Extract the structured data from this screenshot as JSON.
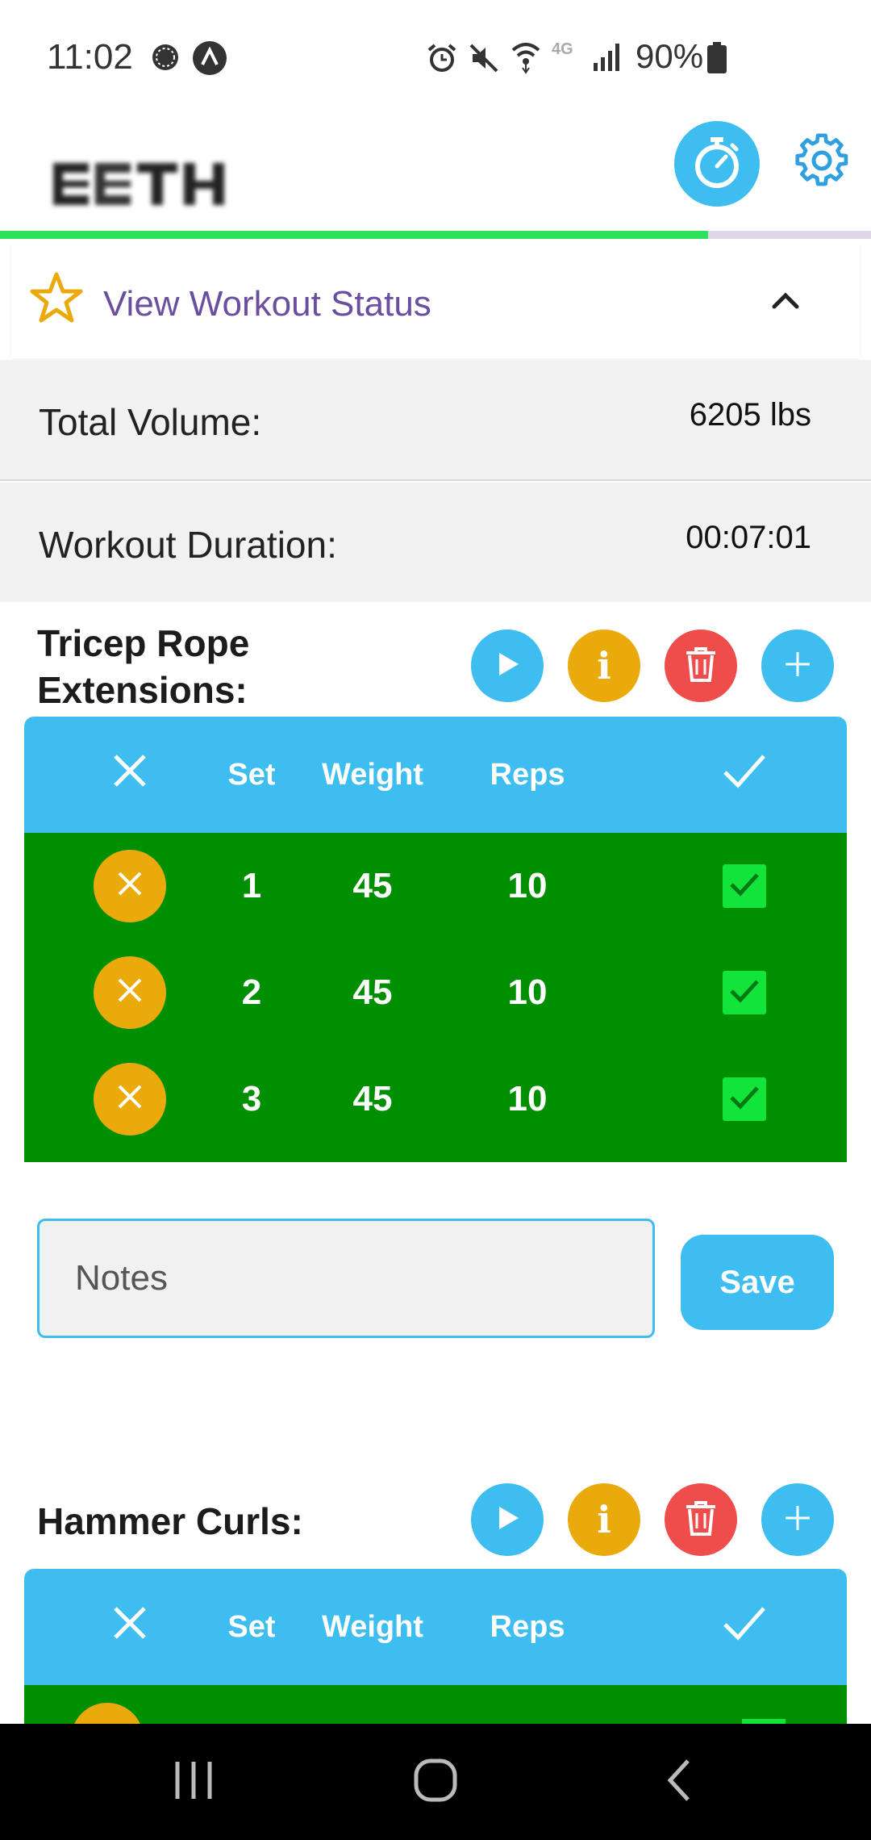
{
  "status_bar": {
    "time": "11:02",
    "battery": "90%",
    "icons": [
      "messenger-icon",
      "app-icon",
      "alarm-icon",
      "mute-icon",
      "wifi-icon",
      "4g-icon",
      "signal-icon",
      "battery-icon"
    ]
  },
  "header": {
    "logo_icon": "blurred-logo",
    "timer_icon": "stopwatch-icon",
    "settings_icon": "gear-icon",
    "progress_fraction": 0.813
  },
  "status_panel": {
    "title": "View Workout Status",
    "stats": [
      {
        "label": "Total Volume:",
        "value": "6205 lbs"
      },
      {
        "label": "Workout Duration:",
        "value": "00:07:01"
      }
    ]
  },
  "table_headers": {
    "set": "Set",
    "weight": "Weight",
    "reps": "Reps"
  },
  "exercises": [
    {
      "name_line1": "Tricep Rope",
      "name_line2": "Extensions:",
      "sets": [
        {
          "set": "1",
          "weight": "45",
          "reps": "10",
          "done": true
        },
        {
          "set": "2",
          "weight": "45",
          "reps": "10",
          "done": true
        },
        {
          "set": "3",
          "weight": "45",
          "reps": "10",
          "done": true
        }
      ],
      "notes_placeholder": "Notes",
      "notes_value": "",
      "save_label": "Save"
    },
    {
      "name_line1": "Hammer Curls:"
    }
  ],
  "colors": {
    "accent_blue": "#3dbdf0",
    "info_yellow": "#eaaa0c",
    "delete_red": "#ef4c4c",
    "completed_green": "#008f00",
    "progress_green": "#2de25a",
    "status_purple": "#6a4ea0"
  }
}
